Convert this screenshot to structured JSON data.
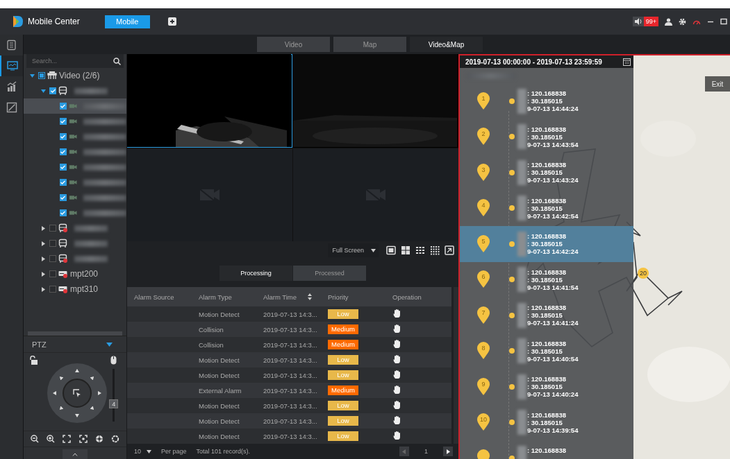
{
  "app": {
    "title": "Mobile Center",
    "tabs": [
      {
        "label": "Mobile",
        "selected": true
      }
    ],
    "alert_count": "99+"
  },
  "rail": [
    {
      "kind": "document",
      "selected": false
    },
    {
      "kind": "monitor",
      "selected": true
    },
    {
      "kind": "chart",
      "selected": false
    },
    {
      "kind": "slash",
      "selected": false
    }
  ],
  "view_tabs": [
    {
      "label": "Video",
      "selected": false
    },
    {
      "label": "Map",
      "selected": false
    },
    {
      "label": "Video&Map",
      "selected": true
    }
  ],
  "tree": {
    "placeholder": "Search...",
    "items": [
      {
        "label": "Video (2/6)",
        "kind": "group",
        "checked": true,
        "partial": true,
        "expanded": true,
        "selected": false,
        "children": [
          {
            "kind": "vehicle",
            "offline": false,
            "checked": true,
            "expanded": true,
            "selected": false,
            "children": [
              {
                "kind": "channel",
                "checked": true,
                "selected": true
              },
              {
                "kind": "channel",
                "checked": true,
                "selected": false
              },
              {
                "kind": "channel",
                "checked": true,
                "selected": false
              },
              {
                "kind": "channel",
                "checked": true,
                "selected": false
              },
              {
                "kind": "channel",
                "checked": true,
                "selected": false
              },
              {
                "kind": "channel",
                "checked": true,
                "selected": false
              },
              {
                "kind": "channel",
                "checked": true,
                "selected": false
              },
              {
                "kind": "channel",
                "checked": true,
                "selected": false
              }
            ]
          },
          {
            "kind": "vehicle",
            "offline": true,
            "checked": false,
            "expanded": false,
            "selected": false
          },
          {
            "kind": "vehicle",
            "offline": false,
            "checked": false,
            "expanded": false,
            "selected": false
          },
          {
            "kind": "vehicle",
            "offline": true,
            "checked": false,
            "expanded": false,
            "selected": false
          },
          {
            "label": "mpt200",
            "kind": "recorder",
            "offline": true,
            "checked": false,
            "expanded": false,
            "selected": false
          },
          {
            "label": "mpt310",
            "kind": "recorder",
            "offline": true,
            "checked": false,
            "expanded": false,
            "selected": false
          }
        ]
      }
    ]
  },
  "ptz": {
    "title": "PTZ",
    "expanded": true,
    "speed": {
      "level": 0.3,
      "reading": "4"
    }
  },
  "video": {
    "mode": "Full Screen",
    "cells": [
      {
        "kind": "live",
        "selected": true
      },
      {
        "kind": "live",
        "selected": false
      },
      {
        "kind": "empty",
        "selected": false
      },
      {
        "kind": "empty",
        "selected": false
      }
    ]
  },
  "alarms": {
    "tabs": [
      {
        "label": "Processing",
        "selected": true
      },
      {
        "label": "Processed",
        "selected": false
      }
    ],
    "columns": [
      {
        "label": "Alarm Source",
        "sortable": false
      },
      {
        "label": "Alarm Type",
        "sortable": false
      },
      {
        "label": "Alarm Time",
        "sortable": true
      },
      {
        "label": "Priority",
        "sortable": false
      },
      {
        "label": "Operation",
        "sortable": false
      }
    ],
    "rows": [
      {
        "type": "Motion Detect",
        "time": "2019-07-13 14:3...",
        "priority": "Low",
        "color": "#e8b84a"
      },
      {
        "type": "Collision",
        "time": "2019-07-13 14:3...",
        "priority": "Medium",
        "color": "#ff6a00"
      },
      {
        "type": "Collision",
        "time": "2019-07-13 14:3...",
        "priority": "Medium",
        "color": "#ff6a00"
      },
      {
        "type": "Motion Detect",
        "time": "2019-07-13 14:3...",
        "priority": "Low",
        "color": "#e8b84a"
      },
      {
        "type": "Motion Detect",
        "time": "2019-07-13 14:3...",
        "priority": "Low",
        "color": "#e8b84a"
      },
      {
        "type": "External Alarm",
        "time": "2019-07-13 14:3...",
        "priority": "Medium",
        "color": "#ff6a00"
      },
      {
        "type": "Motion Detect",
        "time": "2019-07-13 14:3...",
        "priority": "Low",
        "color": "#e8b84a"
      },
      {
        "type": "Motion Detect",
        "time": "2019-07-13 14:3...",
        "priority": "Low",
        "color": "#e8b84a"
      },
      {
        "type": "Motion Detect",
        "time": "2019-07-13 14:3...",
        "priority": "Low",
        "color": "#e8b84a"
      }
    ],
    "page_size": "10",
    "page_size_label": "Per page",
    "total": "Total 101 record(s).",
    "page": "1"
  },
  "track": {
    "range": "2019-07-13 00:00:00 - 2019-07-13 23:59:59",
    "points": [
      {
        "number": "1",
        "lon": ": 120.168838",
        "lat": ": 30.185015",
        "time": "9-07-13 14:44:24",
        "selected": false
      },
      {
        "number": "2",
        "lon": ": 120.168838",
        "lat": ": 30.185015",
        "time": "9-07-13 14:43:54",
        "selected": false
      },
      {
        "number": "3",
        "lon": ": 120.168838",
        "lat": ": 30.185015",
        "time": "9-07-13 14:43:24",
        "selected": false
      },
      {
        "number": "4",
        "lon": ": 120.168838",
        "lat": ": 30.185015",
        "time": "9-07-13 14:42:54",
        "selected": false
      },
      {
        "number": "5",
        "lon": ": 120.168838",
        "lat": ": 30.185015",
        "time": "9-07-13 14:42:24",
        "selected": true
      },
      {
        "number": "6",
        "lon": ": 120.168838",
        "lat": ": 30.185015",
        "time": "9-07-13 14:41:54",
        "selected": false
      },
      {
        "number": "7",
        "lon": ": 120.168838",
        "lat": ": 30.185015",
        "time": "9-07-13 14:41:24",
        "selected": false
      },
      {
        "number": "8",
        "lon": ": 120.168838",
        "lat": ": 30.185015",
        "time": "9-07-13 14:40:54",
        "selected": false
      },
      {
        "number": "9",
        "lon": ": 120.168838",
        "lat": ": 30.185015",
        "time": "9-07-13 14:40:24",
        "selected": false
      },
      {
        "number": "10",
        "lon": ": 120.168838",
        "lat": ": 30.185015",
        "time": "9-07-13 14:39:54",
        "selected": false
      },
      {
        "lon": ": 120.168838",
        "selected": false
      }
    ],
    "map": {
      "marker": "20",
      "exit": "Exit"
    }
  }
}
